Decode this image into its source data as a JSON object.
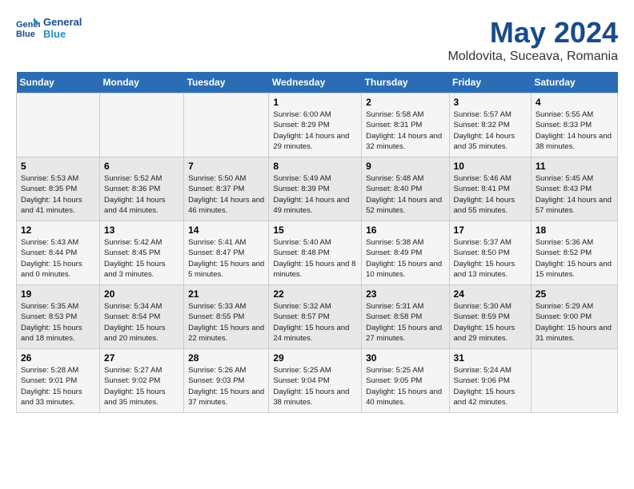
{
  "header": {
    "logo_line1": "General",
    "logo_line2": "Blue",
    "month": "May 2024",
    "location": "Moldovita, Suceava, Romania"
  },
  "weekdays": [
    "Sunday",
    "Monday",
    "Tuesday",
    "Wednesday",
    "Thursday",
    "Friday",
    "Saturday"
  ],
  "weeks": [
    [
      {
        "day": "",
        "sunrise": "",
        "sunset": "",
        "daylight": ""
      },
      {
        "day": "",
        "sunrise": "",
        "sunset": "",
        "daylight": ""
      },
      {
        "day": "",
        "sunrise": "",
        "sunset": "",
        "daylight": ""
      },
      {
        "day": "1",
        "sunrise": "Sunrise: 6:00 AM",
        "sunset": "Sunset: 8:29 PM",
        "daylight": "Daylight: 14 hours and 29 minutes."
      },
      {
        "day": "2",
        "sunrise": "Sunrise: 5:58 AM",
        "sunset": "Sunset: 8:31 PM",
        "daylight": "Daylight: 14 hours and 32 minutes."
      },
      {
        "day": "3",
        "sunrise": "Sunrise: 5:57 AM",
        "sunset": "Sunset: 8:32 PM",
        "daylight": "Daylight: 14 hours and 35 minutes."
      },
      {
        "day": "4",
        "sunrise": "Sunrise: 5:55 AM",
        "sunset": "Sunset: 8:33 PM",
        "daylight": "Daylight: 14 hours and 38 minutes."
      }
    ],
    [
      {
        "day": "5",
        "sunrise": "Sunrise: 5:53 AM",
        "sunset": "Sunset: 8:35 PM",
        "daylight": "Daylight: 14 hours and 41 minutes."
      },
      {
        "day": "6",
        "sunrise": "Sunrise: 5:52 AM",
        "sunset": "Sunset: 8:36 PM",
        "daylight": "Daylight: 14 hours and 44 minutes."
      },
      {
        "day": "7",
        "sunrise": "Sunrise: 5:50 AM",
        "sunset": "Sunset: 8:37 PM",
        "daylight": "Daylight: 14 hours and 46 minutes."
      },
      {
        "day": "8",
        "sunrise": "Sunrise: 5:49 AM",
        "sunset": "Sunset: 8:39 PM",
        "daylight": "Daylight: 14 hours and 49 minutes."
      },
      {
        "day": "9",
        "sunrise": "Sunrise: 5:48 AM",
        "sunset": "Sunset: 8:40 PM",
        "daylight": "Daylight: 14 hours and 52 minutes."
      },
      {
        "day": "10",
        "sunrise": "Sunrise: 5:46 AM",
        "sunset": "Sunset: 8:41 PM",
        "daylight": "Daylight: 14 hours and 55 minutes."
      },
      {
        "day": "11",
        "sunrise": "Sunrise: 5:45 AM",
        "sunset": "Sunset: 8:43 PM",
        "daylight": "Daylight: 14 hours and 57 minutes."
      }
    ],
    [
      {
        "day": "12",
        "sunrise": "Sunrise: 5:43 AM",
        "sunset": "Sunset: 8:44 PM",
        "daylight": "Daylight: 15 hours and 0 minutes."
      },
      {
        "day": "13",
        "sunrise": "Sunrise: 5:42 AM",
        "sunset": "Sunset: 8:45 PM",
        "daylight": "Daylight: 15 hours and 3 minutes."
      },
      {
        "day": "14",
        "sunrise": "Sunrise: 5:41 AM",
        "sunset": "Sunset: 8:47 PM",
        "daylight": "Daylight: 15 hours and 5 minutes."
      },
      {
        "day": "15",
        "sunrise": "Sunrise: 5:40 AM",
        "sunset": "Sunset: 8:48 PM",
        "daylight": "Daylight: 15 hours and 8 minutes."
      },
      {
        "day": "16",
        "sunrise": "Sunrise: 5:38 AM",
        "sunset": "Sunset: 8:49 PM",
        "daylight": "Daylight: 15 hours and 10 minutes."
      },
      {
        "day": "17",
        "sunrise": "Sunrise: 5:37 AM",
        "sunset": "Sunset: 8:50 PM",
        "daylight": "Daylight: 15 hours and 13 minutes."
      },
      {
        "day": "18",
        "sunrise": "Sunrise: 5:36 AM",
        "sunset": "Sunset: 8:52 PM",
        "daylight": "Daylight: 15 hours and 15 minutes."
      }
    ],
    [
      {
        "day": "19",
        "sunrise": "Sunrise: 5:35 AM",
        "sunset": "Sunset: 8:53 PM",
        "daylight": "Daylight: 15 hours and 18 minutes."
      },
      {
        "day": "20",
        "sunrise": "Sunrise: 5:34 AM",
        "sunset": "Sunset: 8:54 PM",
        "daylight": "Daylight: 15 hours and 20 minutes."
      },
      {
        "day": "21",
        "sunrise": "Sunrise: 5:33 AM",
        "sunset": "Sunset: 8:55 PM",
        "daylight": "Daylight: 15 hours and 22 minutes."
      },
      {
        "day": "22",
        "sunrise": "Sunrise: 5:32 AM",
        "sunset": "Sunset: 8:57 PM",
        "daylight": "Daylight: 15 hours and 24 minutes."
      },
      {
        "day": "23",
        "sunrise": "Sunrise: 5:31 AM",
        "sunset": "Sunset: 8:58 PM",
        "daylight": "Daylight: 15 hours and 27 minutes."
      },
      {
        "day": "24",
        "sunrise": "Sunrise: 5:30 AM",
        "sunset": "Sunset: 8:59 PM",
        "daylight": "Daylight: 15 hours and 29 minutes."
      },
      {
        "day": "25",
        "sunrise": "Sunrise: 5:29 AM",
        "sunset": "Sunset: 9:00 PM",
        "daylight": "Daylight: 15 hours and 31 minutes."
      }
    ],
    [
      {
        "day": "26",
        "sunrise": "Sunrise: 5:28 AM",
        "sunset": "Sunset: 9:01 PM",
        "daylight": "Daylight: 15 hours and 33 minutes."
      },
      {
        "day": "27",
        "sunrise": "Sunrise: 5:27 AM",
        "sunset": "Sunset: 9:02 PM",
        "daylight": "Daylight: 15 hours and 35 minutes."
      },
      {
        "day": "28",
        "sunrise": "Sunrise: 5:26 AM",
        "sunset": "Sunset: 9:03 PM",
        "daylight": "Daylight: 15 hours and 37 minutes."
      },
      {
        "day": "29",
        "sunrise": "Sunrise: 5:25 AM",
        "sunset": "Sunset: 9:04 PM",
        "daylight": "Daylight: 15 hours and 38 minutes."
      },
      {
        "day": "30",
        "sunrise": "Sunrise: 5:25 AM",
        "sunset": "Sunset: 9:05 PM",
        "daylight": "Daylight: 15 hours and 40 minutes."
      },
      {
        "day": "31",
        "sunrise": "Sunrise: 5:24 AM",
        "sunset": "Sunset: 9:06 PM",
        "daylight": "Daylight: 15 hours and 42 minutes."
      },
      {
        "day": "",
        "sunrise": "",
        "sunset": "",
        "daylight": ""
      }
    ]
  ]
}
